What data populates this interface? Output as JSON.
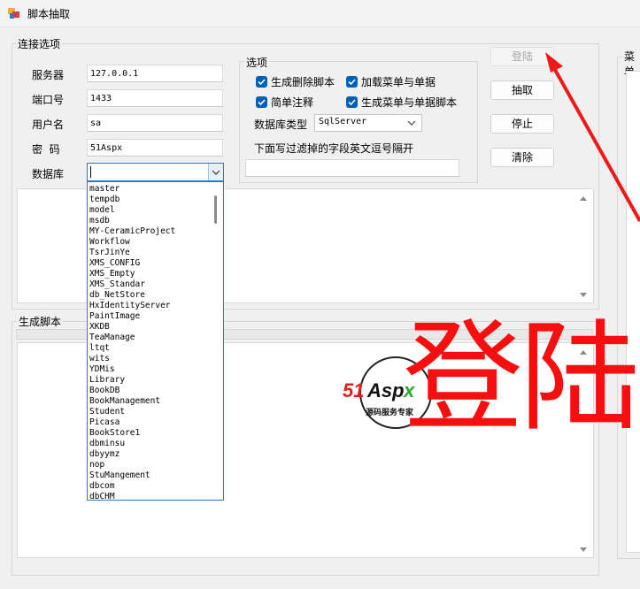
{
  "window": {
    "title": "脚本抽取"
  },
  "connection": {
    "group_label": "连接选项",
    "server_label": "服务器",
    "server_value": "127.0.0.1",
    "port_label": "端口号",
    "port_value": "1433",
    "user_label": "用户名",
    "user_value": "sa",
    "password_label": "密  码",
    "password_value": "51Aspx",
    "database_label": "数据库",
    "database_value": ""
  },
  "options": {
    "group_label": "选项",
    "gen_delete_label": "生成删除脚本",
    "gen_delete_checked": true,
    "load_menu_label": "加载菜单与单据",
    "load_menu_checked": true,
    "simple_comment_label": "简单注释",
    "simple_comment_checked": true,
    "gen_menu_script_label": "生成菜单与单据脚本",
    "gen_menu_script_checked": true,
    "db_type_label": "数据库类型",
    "db_type_value": "SqlServer",
    "filter_label": "下面写过滤掉的字段英文逗号隔开",
    "filter_value": ""
  },
  "buttons": {
    "login": "登陆",
    "extract": "抽取",
    "stop": "停止",
    "clear": "清除"
  },
  "database_list": [
    "master",
    "tempdb",
    "model",
    "msdb",
    "MY-CeramicProject",
    "Workflow",
    "TsrJinYe",
    "XMS_CONFIG",
    "XMS_Empty",
    "XMS_Standar",
    "db_NetStore",
    "HxIdentityServer",
    "PaintImage",
    "XKDB",
    "TeaManage",
    "ltqt",
    "wits",
    "YDMis",
    "Library",
    "BookDB",
    "BookManagement",
    "Student",
    "Picasa",
    "BookStore1",
    "dbminsu",
    "dbyymz",
    "nop",
    "StuMangement",
    "dbcom",
    "dbCHM"
  ],
  "script_section": {
    "label": "生成脚本"
  },
  "menu_section": {
    "label": "菜单"
  },
  "watermark": {
    "logo_main": "51Aspx",
    "logo_sub": "源码服务专家"
  },
  "annotation": {
    "text": "登陆",
    "color": "#f70f0f"
  },
  "colors": {
    "accent": "#005fb8",
    "focus": "#1e7bd6"
  }
}
